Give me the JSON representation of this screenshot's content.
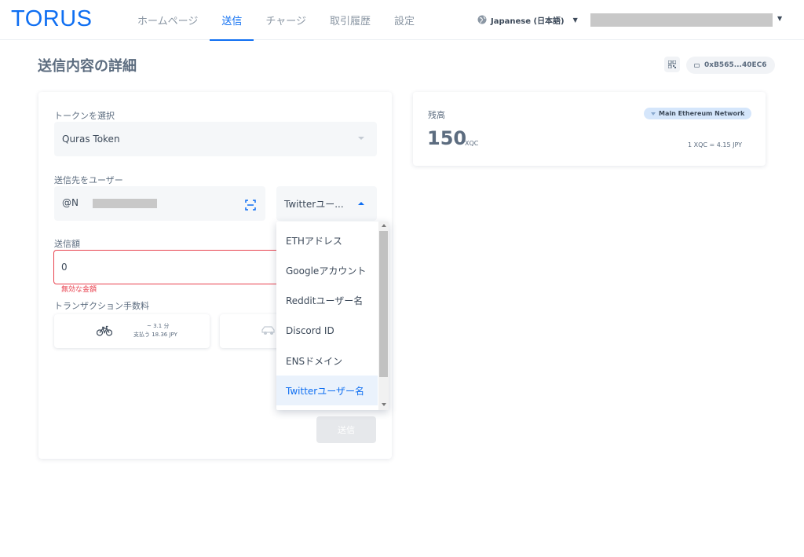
{
  "app": {
    "logo": "TORUS"
  },
  "nav": {
    "items": [
      {
        "label": "ホームページ",
        "active": false
      },
      {
        "label": "送信",
        "active": true
      },
      {
        "label": "チャージ",
        "active": false
      },
      {
        "label": "取引履歴",
        "active": false
      },
      {
        "label": "設定",
        "active": false
      }
    ]
  },
  "header": {
    "language": "Japanese (日本語)"
  },
  "page": {
    "title": "送信内容の詳細",
    "address": "0xB565...40EC6"
  },
  "form": {
    "token_label": "トークンを選択",
    "token_value": "Quras Token",
    "recipient_label": "送信先をユーザー",
    "recipient_value": "@N",
    "recipient_type_value": "Twitterユー...",
    "amount_label": "送信額",
    "amount_value": "0",
    "amount_error": "無効な金額",
    "fee_label": "トランザクション手数料",
    "fee_slow_time": "~ 3.1 分",
    "fee_slow_cost": "支払う 18.36 JPY",
    "send_label": "送信"
  },
  "dropdown": {
    "options": [
      {
        "label": "ETHアドレス",
        "selected": false
      },
      {
        "label": "Googleアカウント",
        "selected": false
      },
      {
        "label": "Redditユーザー名",
        "selected": false
      },
      {
        "label": "Discord ID",
        "selected": false
      },
      {
        "label": "ENSドメイン",
        "selected": false
      },
      {
        "label": "Twitterユーザー名",
        "selected": true
      }
    ]
  },
  "balance": {
    "label": "残高",
    "network": "Main Ethereum Network",
    "value": "150",
    "unit": "XQC",
    "rate": "1 XQC = 4.15 JPY"
  },
  "colors": {
    "brand": "#0f6ff2",
    "error": "#e8424f",
    "text": "#5c6c7f"
  }
}
